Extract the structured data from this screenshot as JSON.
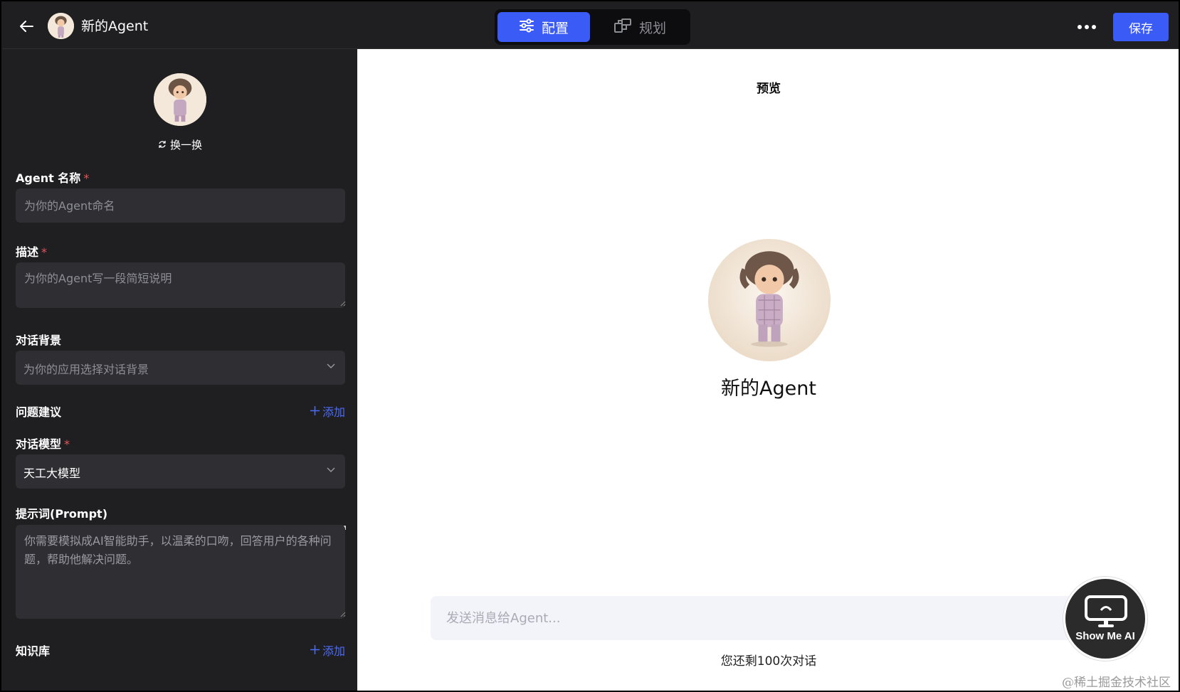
{
  "header": {
    "title": "新的Agent",
    "tabs": [
      {
        "label": "配置",
        "active": true,
        "icon": "sliders-icon"
      },
      {
        "label": "规划",
        "active": false,
        "icon": "flow-icon"
      }
    ],
    "save_label": "保存",
    "accent_color": "#3b5bf7"
  },
  "form": {
    "swap_label": "换一换",
    "name": {
      "label": "Agent 名称",
      "required": "*",
      "placeholder": "为你的Agent命名"
    },
    "description": {
      "label": "描述",
      "required": "*",
      "placeholder": "为你的Agent写一段简短说明"
    },
    "background": {
      "label": "对话背景",
      "placeholder": "为你的应用选择对话背景"
    },
    "suggestions": {
      "label": "问题建议",
      "add_label": "添加"
    },
    "model": {
      "label": "对话模型",
      "required": "*",
      "value": "天工大模型"
    },
    "prompt": {
      "label": "提示词(Prompt)",
      "value": "你需要模拟成AI智能助手，以温柔的口吻，回答用户的各种问题，帮助他解决问题。"
    },
    "knowledge": {
      "label": "知识库",
      "add_label": "添加"
    }
  },
  "preview": {
    "title": "预览",
    "agent_name": "新的Agent",
    "message_placeholder": "发送消息给Agent...",
    "remaining": "您还剩100次对话"
  },
  "watermark": {
    "logo_text": "Show Me AI",
    "credit": "@稀土掘金技术社区"
  }
}
